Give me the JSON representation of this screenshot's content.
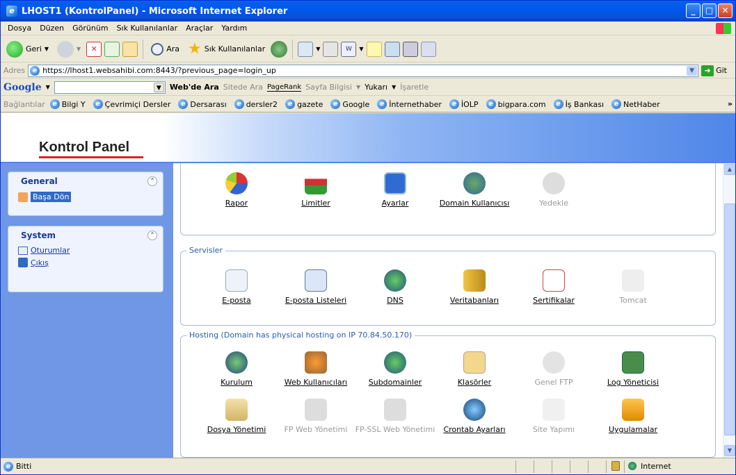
{
  "window": {
    "title": "LHOST1 (KontrolPanel) - Microsoft Internet Explorer"
  },
  "menu": [
    "Dosya",
    "Düzen",
    "Görünüm",
    "Sık Kullanılanlar",
    "Araçlar",
    "Yardım"
  ],
  "toolbar": {
    "back": "Geri",
    "search": "Ara",
    "favorites": "Sık Kullanılanlar"
  },
  "address": {
    "label": "Adres",
    "url": "https://lhost1.websahibi.com:8443/?previous_page=login_up",
    "go": "Git"
  },
  "google": {
    "logo": "Google",
    "webde_ara": "Web'de Ara",
    "sitede_ara": "Sitede Ara",
    "pagerank": "PageRank",
    "sayfa_bilgisi": "Sayfa Bilgisi",
    "yukari": "Yukarı",
    "isaretle": "İşaretle"
  },
  "links": {
    "label": "Bağlantılar",
    "items": [
      "Bilgi Y",
      "Çevrimiçi Dersler",
      "Dersarası",
      "dersler2",
      "gazete",
      "Google",
      "İnternethaber",
      "İOLP",
      "bigpara.com",
      "İş Bankası",
      "NetHaber"
    ]
  },
  "banner": {
    "title": "Kontrol Panel"
  },
  "sidebar": {
    "general": {
      "title": "General",
      "items": [
        "Başa Dön"
      ]
    },
    "system": {
      "title": "System",
      "items": [
        "Oturumlar",
        "Çıkış"
      ]
    }
  },
  "sections": {
    "top": {
      "items": [
        {
          "label": "Rapor",
          "enabled": true,
          "icon": "pie-chart-icon"
        },
        {
          "label": "Limitler",
          "enabled": true,
          "icon": "gauge-icon"
        },
        {
          "label": "Ayarlar",
          "enabled": true,
          "icon": "settings-window-icon"
        },
        {
          "label": "Domain Kullanıcısı",
          "enabled": true,
          "icon": "users-globe-icon"
        },
        {
          "label": "Yedekle",
          "enabled": false,
          "icon": "backup-icon"
        }
      ]
    },
    "servisler": {
      "legend": "Servisler",
      "items": [
        {
          "label": "E-posta",
          "enabled": true,
          "icon": "mail-icon"
        },
        {
          "label": "E-posta Listeleri",
          "enabled": true,
          "icon": "mail-list-icon"
        },
        {
          "label": "DNS",
          "enabled": true,
          "icon": "dns-globe-icon"
        },
        {
          "label": "Veritabanları",
          "enabled": true,
          "icon": "database-icon"
        },
        {
          "label": "Sertifikalar",
          "enabled": true,
          "icon": "certificate-icon"
        },
        {
          "label": "Tomcat",
          "enabled": false,
          "icon": "tomcat-icon"
        }
      ]
    },
    "hosting": {
      "legend": "Hosting (Domain has physical hosting on IP 70.84.50.170)",
      "items": [
        {
          "label": "Kurulum",
          "enabled": true,
          "icon": "globe-house-icon"
        },
        {
          "label": "Web Kullanıcıları",
          "enabled": true,
          "icon": "web-users-icon"
        },
        {
          "label": "Subdomainler",
          "enabled": true,
          "icon": "subdomain-globe-icon"
        },
        {
          "label": "Klasörler",
          "enabled": true,
          "icon": "folder-key-icon"
        },
        {
          "label": "Genel FTP",
          "enabled": false,
          "icon": "ftp-icon"
        },
        {
          "label": "Log Yöneticisi",
          "enabled": true,
          "icon": "log-manager-icon"
        },
        {
          "label": "Dosya Yönetimi",
          "enabled": true,
          "icon": "file-cabinet-icon"
        },
        {
          "label": "FP Web Yönetimi",
          "enabled": false,
          "icon": "frontpage-icon"
        },
        {
          "label": "FP-SSL Web Yönetimi",
          "enabled": false,
          "icon": "frontpage-ssl-icon"
        },
        {
          "label": "Crontab Ayarları",
          "enabled": true,
          "icon": "clock-globe-icon"
        },
        {
          "label": "Site Yapımı",
          "enabled": false,
          "icon": "site-builder-icon"
        },
        {
          "label": "Uygulamalar",
          "enabled": true,
          "icon": "applications-icon"
        }
      ]
    }
  },
  "status": {
    "text": "Bitti",
    "zone": "Internet"
  },
  "colors": {
    "titlebar": "#0058ee",
    "sidebar": "#6f97e6",
    "legend": "#2a5caa"
  }
}
